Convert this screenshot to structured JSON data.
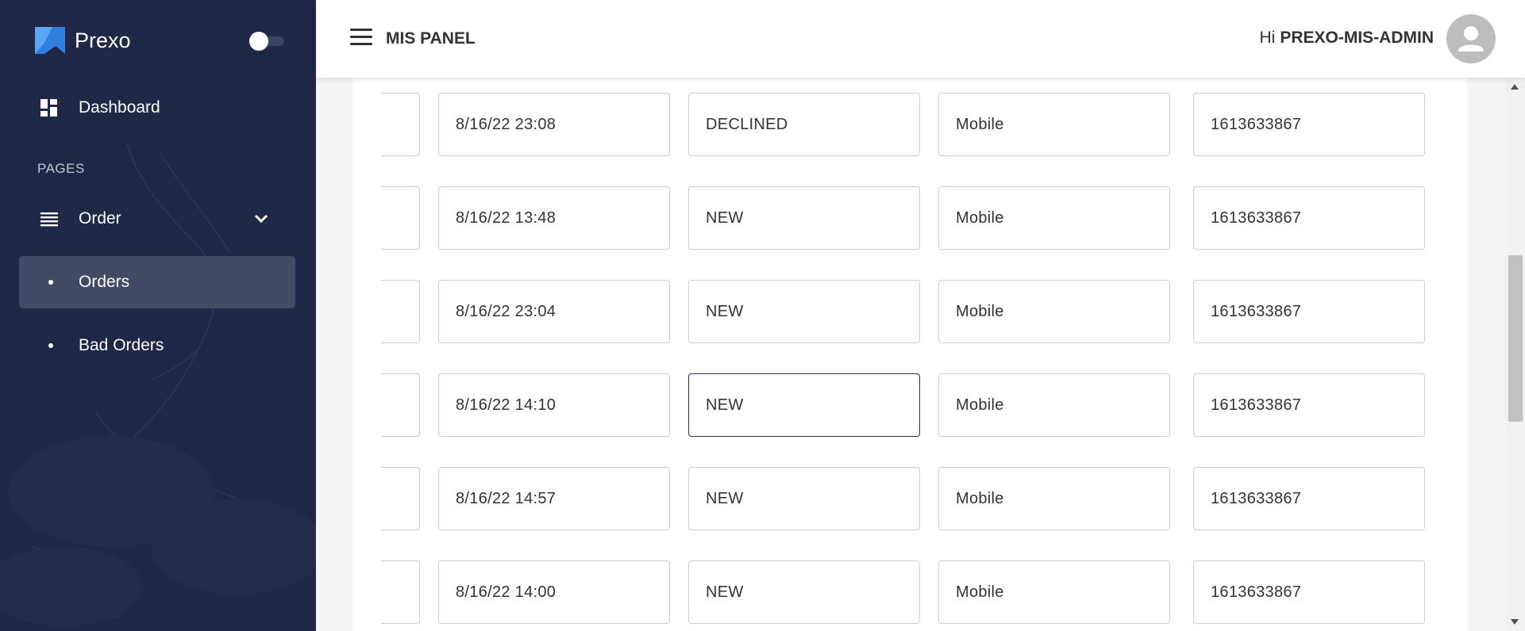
{
  "sidebar": {
    "brand": "Prexo",
    "theme_toggle": "off",
    "dashboard_label": "Dashboard",
    "section_label": "PAGES",
    "order_label": "Order",
    "orders_label": "Orders",
    "bad_orders_label": "Bad Orders"
  },
  "header": {
    "title": "MIS PANEL",
    "greeting": "Hi",
    "username": "PREXO-MIS-ADMIN"
  },
  "rows": [
    {
      "date": "8/16/22 23:08",
      "status": "DECLINED",
      "type": "Mobile",
      "id": "1613633867"
    },
    {
      "date": "8/16/22 13:48",
      "status": "NEW",
      "type": "Mobile",
      "id": "1613633867"
    },
    {
      "date": "8/16/22 23:04",
      "status": "NEW",
      "type": "Mobile",
      "id": "1613633867"
    },
    {
      "date": "8/16/22 14:10",
      "status": "NEW",
      "type": "Mobile",
      "id": "1613633867"
    },
    {
      "date": "8/16/22 14:57",
      "status": "NEW",
      "type": "Mobile",
      "id": "1613633867"
    },
    {
      "date": "8/16/22 14:00",
      "status": "NEW",
      "type": "Mobile",
      "id": "1613633867"
    }
  ],
  "colors": {
    "sidebar_bg": "#1f2847",
    "active_item_bg": "#434b64",
    "focus_border": "#2a3354"
  }
}
